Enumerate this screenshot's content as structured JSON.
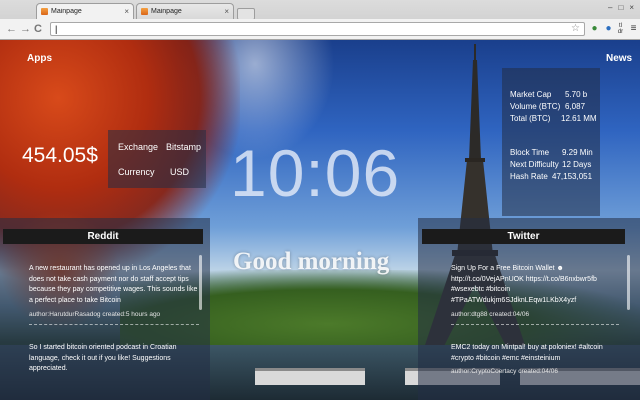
{
  "browser": {
    "tabs": [
      {
        "title": "Mainpage",
        "active": true
      },
      {
        "title": "Mainpage",
        "active": false
      }
    ],
    "close_glyph": "×",
    "window_controls": [
      "–",
      "□",
      "×"
    ],
    "nav": {
      "back": "←",
      "forward": "→",
      "reload": "C"
    },
    "address": "|",
    "extensions": {
      "tldr_top": "tl",
      "tldr_bottom": "dr"
    }
  },
  "page": {
    "apps_label": "Apps",
    "news_label": "News",
    "price": "454.05$",
    "exchange": {
      "label": "Exchange",
      "value": "Bitstamp"
    },
    "currency": {
      "label": "Currency",
      "value": "USD"
    },
    "clock": "10:06",
    "greeting": "Good morning",
    "stats_group1": [
      {
        "label": "Market Cap",
        "value": "5.70 b"
      },
      {
        "label": "Volume (BTC)",
        "value": "6,087"
      },
      {
        "label": "Total (BTC)",
        "value": "12.61 MM"
      }
    ],
    "stats_group2": [
      {
        "label": "Block Time",
        "value": "9.29 Min"
      },
      {
        "label": "Next Difficulty",
        "value": "12 Days"
      },
      {
        "label": "Hash Rate",
        "value": "47,153,051"
      }
    ]
  },
  "reddit": {
    "title": "Reddit",
    "posts": [
      {
        "text": "A new restaurant has opened up in Los Angeles that does not take cash payment nor do staff accept tips because they pay competitive wages. This sounds like a perfect place to take Bitcoin",
        "meta": "author:HarutdurRasadog   created:5 hours ago"
      },
      {
        "text": "So I started bitcoin oriented podcast in Croatian language, check it out if you like! Suggestions appreciated.",
        "meta": ""
      }
    ]
  },
  "twitter": {
    "title": "Twitter",
    "tweets": [
      {
        "text": "Sign Up For a Free Bitcoin Wallet ☻ http://t.co/0VejAPnUOK https://t.co/B6nxbwr5fb #wsexebtc #bitcoin #TPaATWdukjm6SJdknLEqw1LKbX4yzf",
        "meta": "author:dtg88   created:04/06"
      },
      {
        "text": "EMC2 today on Mintpal! buy at poloniex! #altcoin #crypto #bitcoin #emc #einsteinium",
        "meta": "author:CryptoCoertacy   created:04/06"
      }
    ]
  }
}
